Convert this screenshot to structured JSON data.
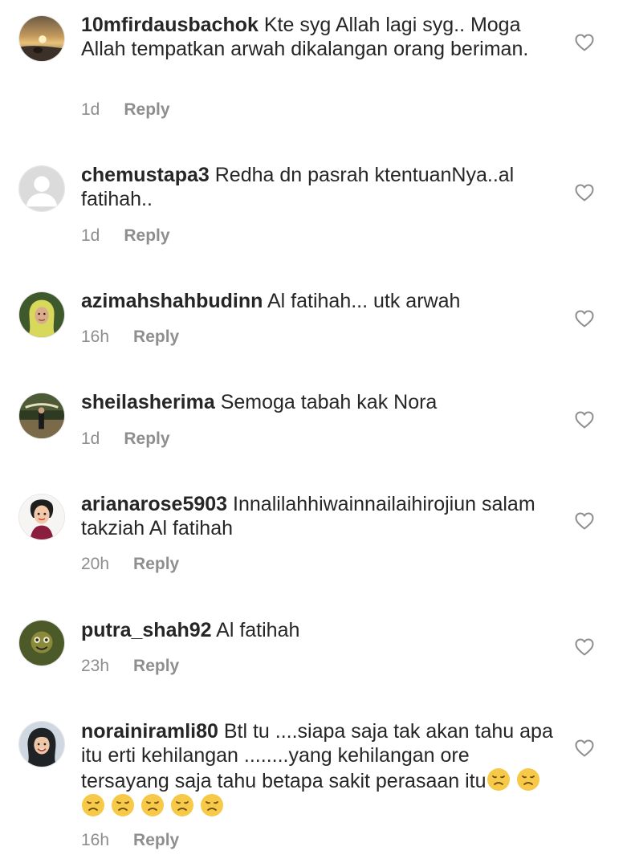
{
  "comments": [
    {
      "username": "10mfirdausbachok",
      "text": "Kte syg Allah lagi syg.. Moga Allah tempatkan arwah dikalangan orang beriman.",
      "time": "1d",
      "reply_label": "Reply",
      "avatar_icon": "sunset-photo-avatar"
    },
    {
      "username": "chemustapa3",
      "text": "Redha dn pasrah ktentuanNya..al fatihah..",
      "time": "1d",
      "reply_label": "Reply",
      "avatar_icon": "default-user-avatar"
    },
    {
      "username": "azimahshahbudinn",
      "text": "Al fatihah... utk arwah",
      "time": "16h",
      "reply_label": "Reply",
      "avatar_icon": "woman-hijab-avatar"
    },
    {
      "username": "sheilasherima",
      "text": "Semoga tabah kak Nora",
      "time": "1d",
      "reply_label": "Reply",
      "avatar_icon": "garden-photo-avatar"
    },
    {
      "username": "arianarose5903",
      "text": "Innalilahhiwainnailaihirojiun salam takziah Al fatihah",
      "time": "20h",
      "reply_label": "Reply",
      "avatar_icon": "cartoon-woman-avatar"
    },
    {
      "username": "putra_shah92",
      "text": "Al fatihah",
      "time": "23h",
      "reply_label": "Reply",
      "avatar_icon": "green-photo-avatar"
    },
    {
      "username": "norainiramli80",
      "text": "Btl tu ....siapa saja tak akan tahu apa itu erti kehilangan ........yang kehilangan ore tersayang saja tahu betapa sakit perasaan itu",
      "time": "16h",
      "reply_label": "Reply",
      "avatar_icon": "woman-hijab-smiling-avatar",
      "emoji": "😞😞😞😞😞😞😞"
    }
  ],
  "colors": {
    "text": "#262626",
    "meta": "#8e8e8e",
    "heart_stroke": "#8e8e8e",
    "background": "#ffffff"
  },
  "icons": {
    "like": "heart-outline-icon",
    "emoji": "disappointed-face-emoji"
  }
}
